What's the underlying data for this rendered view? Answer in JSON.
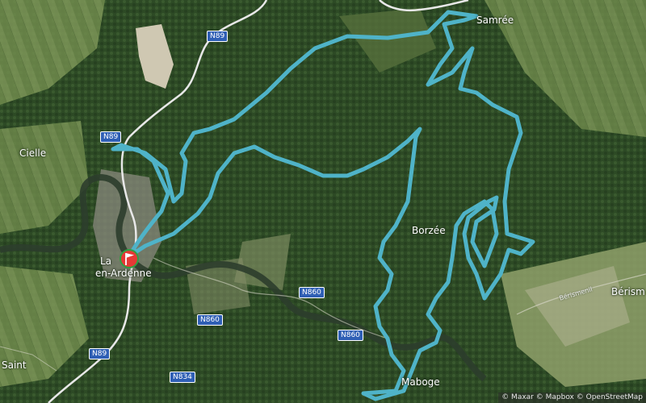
{
  "map": {
    "places": [
      {
        "id": "samree",
        "label": "Samrée"
      },
      {
        "id": "cielle",
        "label": "Cielle"
      },
      {
        "id": "laroche_1",
        "label": "La"
      },
      {
        "id": "laroche_2",
        "label": "en-Ardenne"
      },
      {
        "id": "borzee",
        "label": "Borzée"
      },
      {
        "id": "beris",
        "label": "Bérism"
      },
      {
        "id": "maboge",
        "label": "Maboge"
      },
      {
        "id": "saint",
        "label": "Saint"
      }
    ],
    "street_label": "Bérismenil",
    "road_shields": [
      {
        "id": "n89_top",
        "label": "N89"
      },
      {
        "id": "n89_mid",
        "label": "N89"
      },
      {
        "id": "n860_a",
        "label": "N860"
      },
      {
        "id": "n860_b",
        "label": "N860"
      },
      {
        "id": "n860_c",
        "label": "N860"
      },
      {
        "id": "n89_bottom",
        "label": "N89"
      },
      {
        "id": "n834",
        "label": "N834"
      }
    ],
    "road_shield_color": "#2f5fb5",
    "route_color": "#4fb3c8",
    "marker": {
      "icon": "start-flag-icon",
      "color": "#e53935",
      "ring_color": "#2ea043"
    },
    "attribution": {
      "maxar": "© Maxar",
      "mapbox": "© Mapbox",
      "osm": "© OpenStreetMap"
    }
  }
}
